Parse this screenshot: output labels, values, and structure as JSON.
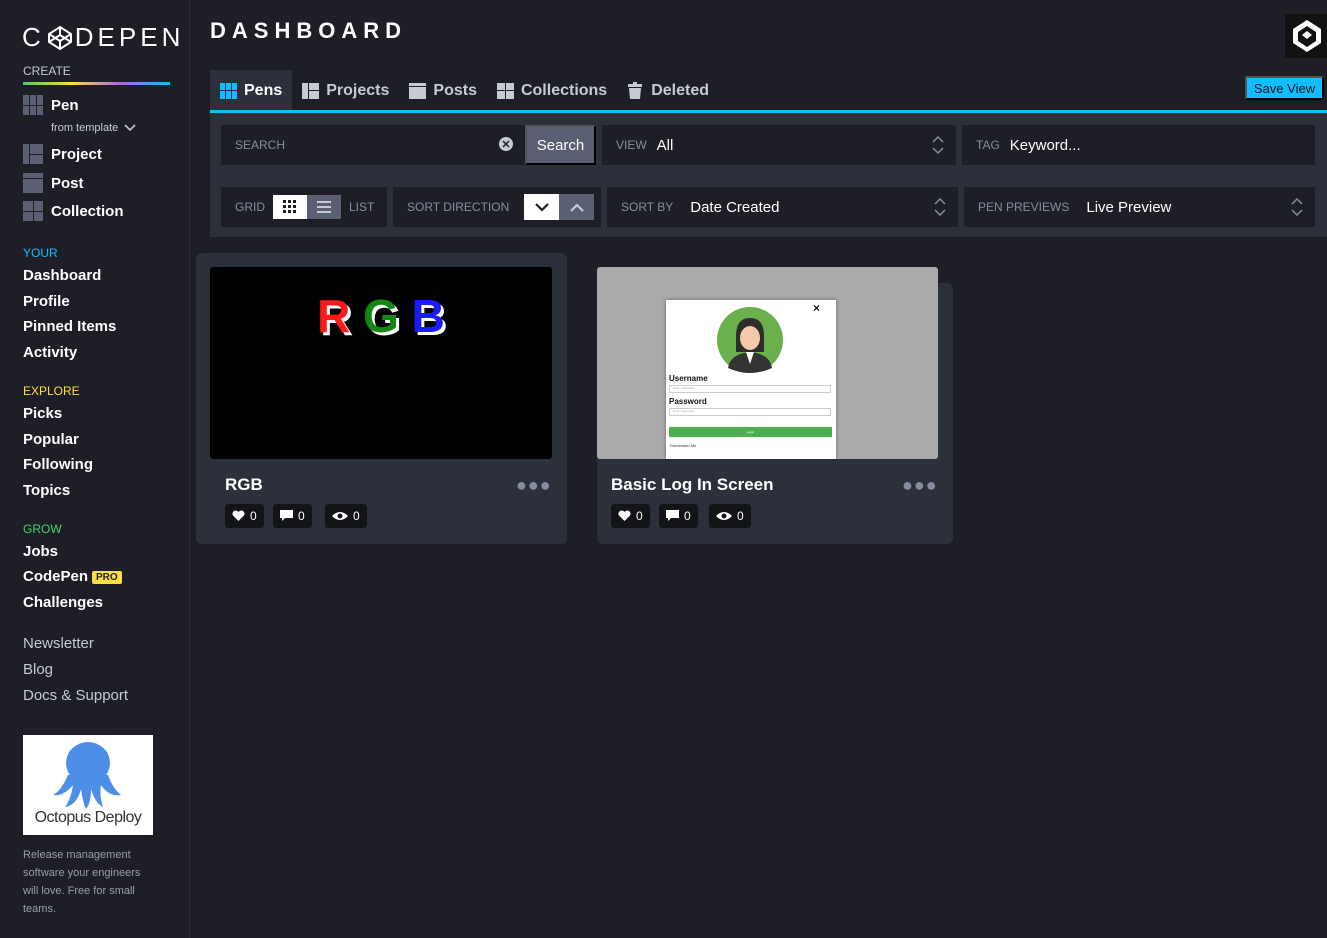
{
  "brand": {
    "logo_text_left": "C",
    "logo_text_right": "DEPEN"
  },
  "sidebar": {
    "create_label": "CREATE",
    "create_items": [
      {
        "label": "Pen",
        "icon": "pen-grid-icon"
      },
      {
        "label": "Project",
        "icon": "project-icon"
      },
      {
        "label": "Post",
        "icon": "post-icon"
      },
      {
        "label": "Collection",
        "icon": "collection-icon"
      }
    ],
    "from_template": "from template",
    "your_label": "YOUR",
    "your_items": [
      "Dashboard",
      "Profile",
      "Pinned Items",
      "Activity"
    ],
    "explore_label": "EXPLORE",
    "explore_items": [
      "Picks",
      "Popular",
      "Following",
      "Topics"
    ],
    "grow_label": "GROW",
    "grow_items": [
      "Jobs",
      "CodePen",
      "Challenges"
    ],
    "pro_badge": "PRO",
    "misc_items": [
      "Newsletter",
      "Blog",
      "Docs & Support"
    ],
    "ad": {
      "title": "Octopus Deploy",
      "description": "Release management software your engineers will love. Free for small teams."
    },
    "colors": {
      "your": "#0ebeff",
      "explore": "#ffdd40",
      "grow": "#47cf73"
    }
  },
  "header": {
    "title": "DASHBOARD",
    "save_view": "Save View"
  },
  "tabs": [
    {
      "label": "Pens",
      "active": true
    },
    {
      "label": "Projects",
      "active": false
    },
    {
      "label": "Posts",
      "active": false
    },
    {
      "label": "Collections",
      "active": false
    },
    {
      "label": "Deleted",
      "active": false
    }
  ],
  "filters": {
    "search_placeholder": "SEARCH",
    "search_button": "Search",
    "view_label": "VIEW",
    "view_value": "All",
    "tag_label": "TAG",
    "tag_value": "Keyword...",
    "grid_label": "GRID",
    "list_label": "LIST",
    "sort_direction_label": "SORT DIRECTION",
    "sort_by_label": "SORT BY",
    "sort_by_value": "Date Created",
    "pen_previews_label": "PEN PREVIEWS",
    "pen_previews_value": "Live Preview"
  },
  "pens": [
    {
      "title": "RGB",
      "preview_letters": [
        "R",
        "G",
        "B"
      ],
      "likes": "0",
      "comments": "0",
      "views": "0"
    },
    {
      "title": "Basic Log In Screen",
      "preview": {
        "close": "×",
        "username_label": "Username",
        "username_placeholder": "Enter Username",
        "password_label": "Password",
        "password_placeholder": "Enter Password",
        "login_button": "Login",
        "remember": "Remember Me"
      },
      "likes": "0",
      "comments": "0",
      "views": "0"
    }
  ]
}
